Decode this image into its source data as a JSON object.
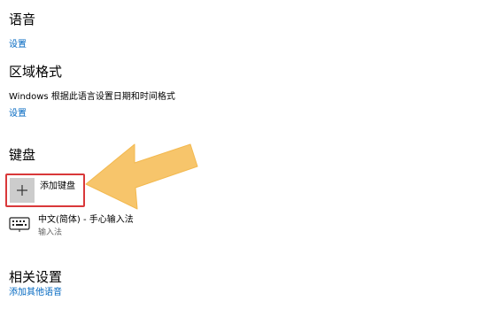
{
  "language": {
    "heading": "语音",
    "settings_link": "设置"
  },
  "region": {
    "heading": "区域格式",
    "description": "Windows 根据此语言设置日期和时间格式",
    "settings_link": "设置"
  },
  "keyboard": {
    "heading": "键盘",
    "add_button_label": "添加键盘",
    "items": [
      {
        "name": "中文(简体) - 手心输入法",
        "subtitle": "输入法"
      }
    ]
  },
  "related": {
    "heading": "相关设置",
    "add_language_link": "添加其他语音"
  },
  "colors": {
    "link": "#0067c0",
    "highlight_border": "#d9383a",
    "arrow_fill": "#f7c56b"
  }
}
